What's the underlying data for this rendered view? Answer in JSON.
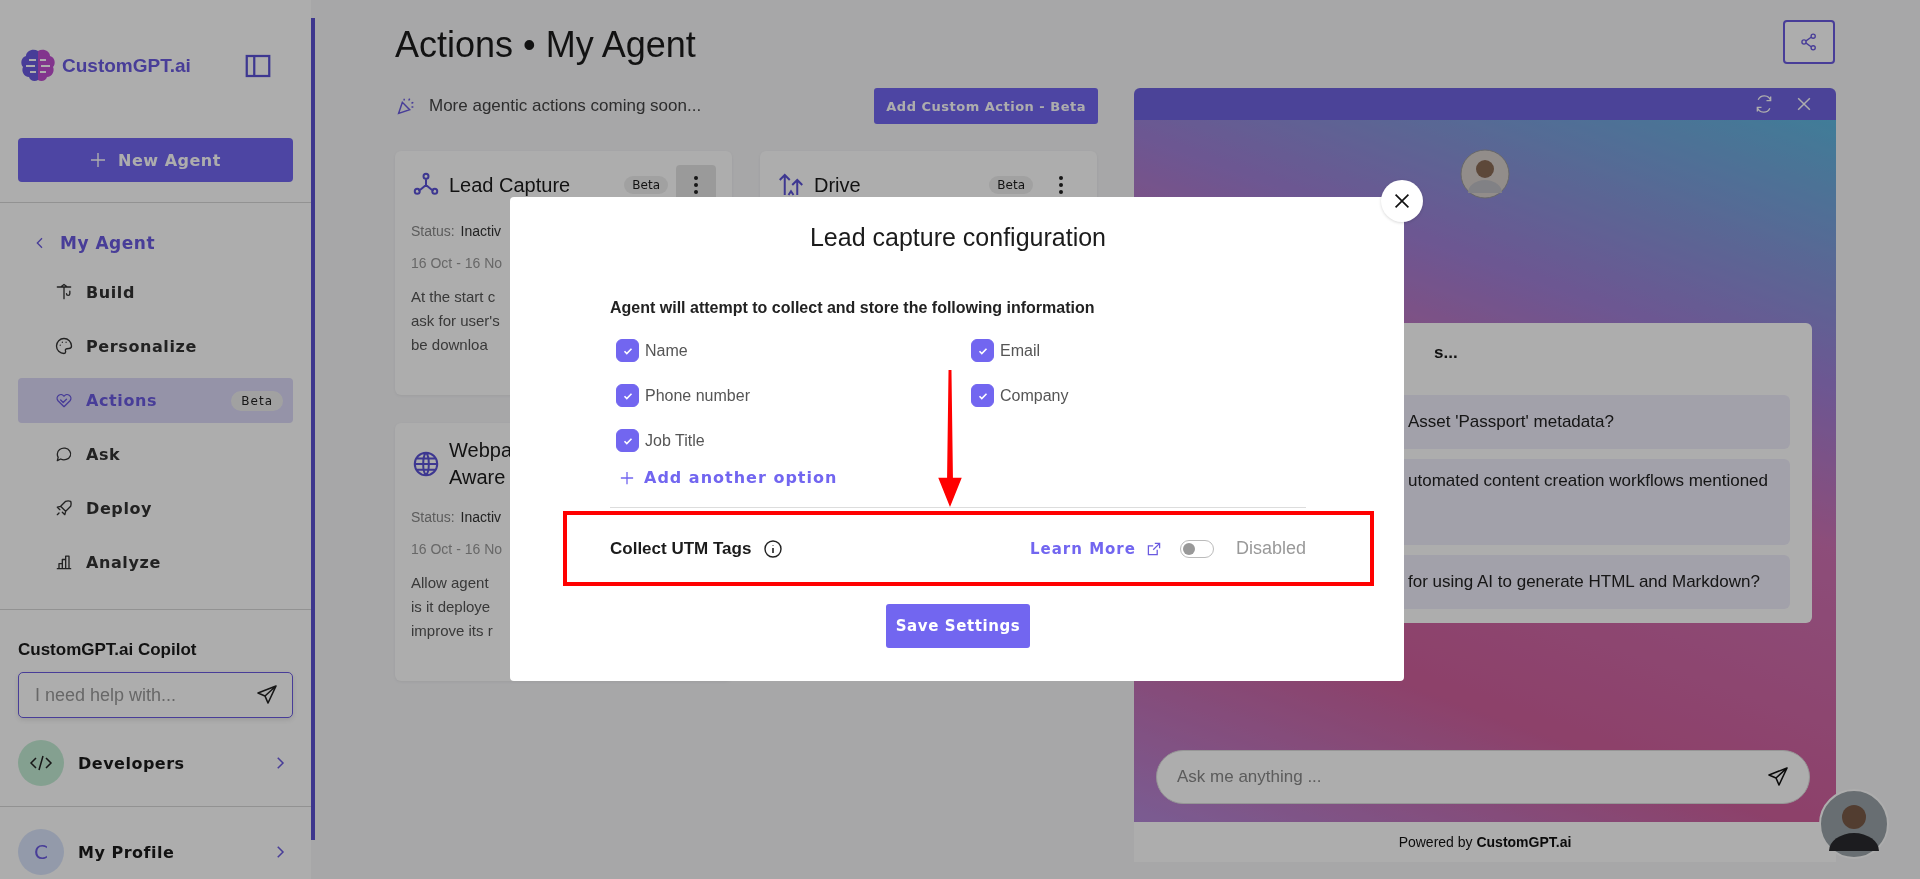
{
  "sidebar": {
    "logo": "CustomGPT.ai",
    "new_agent": "New Agent",
    "back": "My Agent",
    "nav": [
      {
        "label": "Build",
        "selected": false
      },
      {
        "label": "Personalize",
        "selected": false
      },
      {
        "label": "Actions",
        "selected": true,
        "badge": "Beta"
      },
      {
        "label": "Ask",
        "selected": false
      },
      {
        "label": "Deploy",
        "selected": false
      },
      {
        "label": "Analyze",
        "selected": false
      }
    ],
    "copilot": {
      "title": "CustomGPT.ai Copilot",
      "placeholder": "I need help with..."
    },
    "developers": {
      "label": "Developers"
    },
    "profile": {
      "initial": "C",
      "label": "My Profile"
    }
  },
  "main": {
    "title": "Actions • My Agent",
    "notice": "More agentic actions coming soon...",
    "add_button": "Add Custom Action - Beta",
    "cards": [
      {
        "title": "Lead Capture",
        "badge": "Beta",
        "status_label": "Status:",
        "status": "Inactiv",
        "dates": "16 Oct - 16 No",
        "description": "At the start c\nask for user's\nbe downloa"
      },
      {
        "title": "Drive",
        "badge": "Beta"
      },
      {
        "title": "Webpa\nAware",
        "status_label": "Status:",
        "status": "Inactiv",
        "dates": "16 Oct - 16 No",
        "description": "Allow agent\nis it deploye\nimprove its r"
      }
    ]
  },
  "chat": {
    "suggestions_heading": "s...",
    "suggestions": [
      "Asset 'Passport' metadata?",
      "utomated content creation workflows mentioned",
      "for using AI to generate HTML and Markdown?"
    ],
    "placeholder": "Ask me anything ...",
    "powered": "Powered by **CustomGPT.ai**"
  },
  "modal": {
    "title": "Lead capture configuration",
    "subtitle": "Agent will attempt to collect and store the following information",
    "fields": [
      {
        "label": "Name",
        "checked": true
      },
      {
        "label": "Email",
        "checked": true
      },
      {
        "label": "Phone number",
        "checked": true
      },
      {
        "label": "Company",
        "checked": true
      },
      {
        "label": "Job Title",
        "checked": true
      }
    ],
    "add_option": "Add another option",
    "utm_label": "Collect UTM Tags",
    "learn_more": "Learn More",
    "utm_toggle": {
      "on": false,
      "status": "Disabled"
    },
    "save": "Save Settings"
  }
}
